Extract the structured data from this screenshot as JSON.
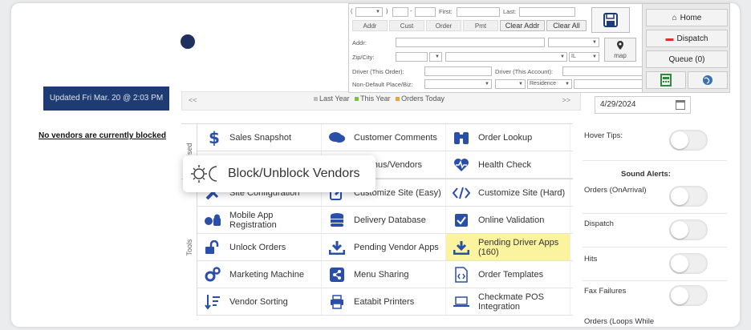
{
  "updated": "Updated Fri Mar. 20 @ 2:03 PM",
  "blocked_msg": "No vendors are currently blocked",
  "legend": {
    "prev": "<<",
    "next": ">>",
    "last_year": "Last Year",
    "this_year": "This Year",
    "orders_today": "Orders Today",
    "colors": {
      "last_year": "#bdbdbd",
      "this_year": "#7cc242",
      "orders_today": "#f0a030"
    }
  },
  "sections": {
    "used": "Used",
    "tools": "Tools"
  },
  "tiles": {
    "sales_snapshot": "Sales Snapshot",
    "customer_comments": "Customer Comments",
    "order_lookup": "Order Lookup",
    "edit_menus": "it Menus/Vendors",
    "health_check": "Health Check",
    "site_configuration": "Site Configuration",
    "customize_easy": "Customize Site (Easy)",
    "customize_hard": "Customize Site (Hard)",
    "mobile_app": "Mobile App Registration",
    "delivery_db": "Delivery Database",
    "online_validation": "Online Validation",
    "unlock_orders": "Unlock Orders",
    "pending_vendor": "Pending Vendor Apps",
    "pending_driver": "Pending Driver Apps (160)",
    "marketing": "Marketing Machine",
    "menu_sharing": "Menu Sharing",
    "order_templates": "Order Templates",
    "vendor_sorting": "Vendor Sorting",
    "eatabit": "Eatabit Printers",
    "checkmate": "Checkmate POS Integration"
  },
  "tooltip": "Block/Unblock Vendors",
  "right_panel": {
    "date": "4/29/2024",
    "hover_tips": "Hover Tips:",
    "sound_alerts": "Sound Alerts:",
    "orders_on_arrival": "Orders (OnArrival)",
    "dispatch": "Dispatch",
    "hits": "Hits",
    "fax_failures": "Fax Failures",
    "orders_loops": "Orders (Loops While"
  },
  "toolbar": {
    "paren_open": "(",
    "paren_close": ")",
    "dash": "-",
    "first_label": "First:",
    "last_label": "Last:",
    "tabs": [
      "Addr",
      "Cust",
      "Order",
      "Pmt"
    ],
    "clear_addr": "Clear Addr",
    "clear_all": "Clear All",
    "addr_label": "Addr:",
    "zip_label": "Zip/City:",
    "state": "IL",
    "map": "map",
    "driver_order": "Driver (This Order):",
    "driver_account": "Driver (This Account):",
    "non_default": "Non-Default Place/Biz:",
    "residence": "Residence"
  },
  "right_buttons": {
    "home": "Home",
    "dispatch": "Dispatch",
    "queue": "Queue (0)"
  },
  "colors": {
    "navy": "#1f3b73",
    "highlight": "#fbf39e",
    "icon_blue": "#2a4fa8"
  }
}
